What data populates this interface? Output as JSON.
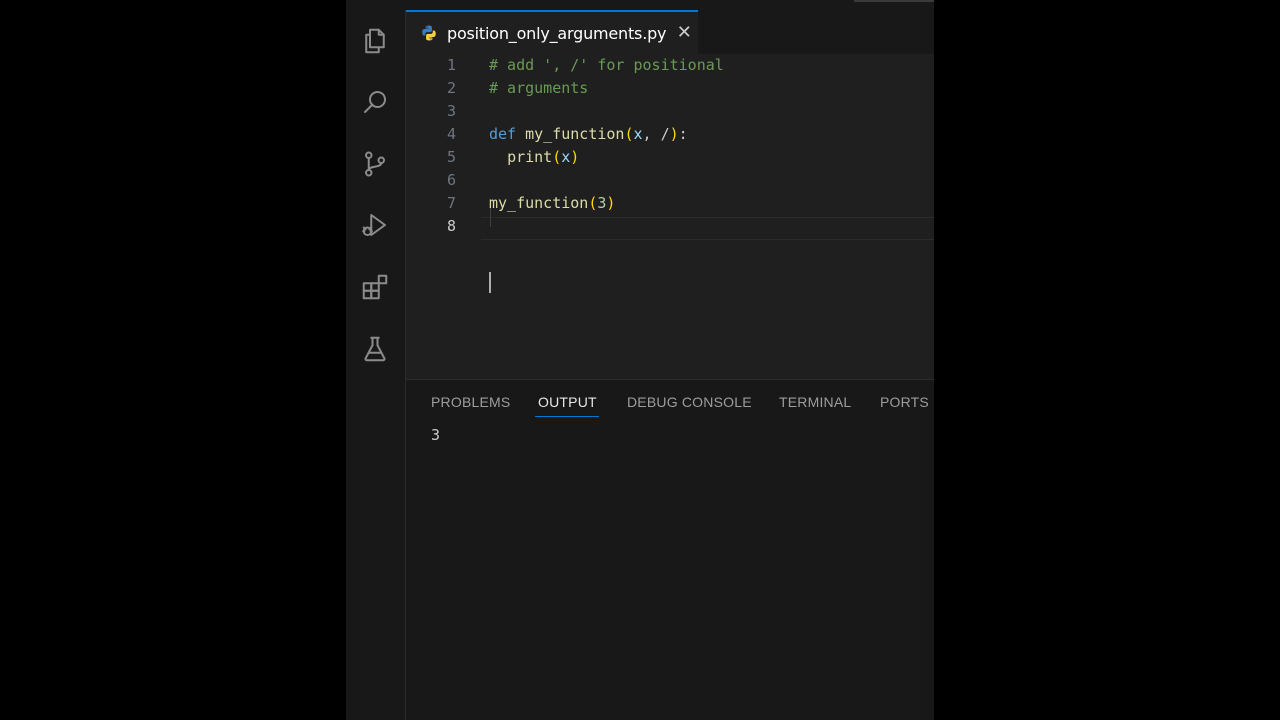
{
  "activity_bar": {
    "icons": [
      "explorer-icon",
      "search-icon",
      "source-control-icon",
      "run-debug-icon",
      "extensions-icon",
      "testing-icon"
    ]
  },
  "editor_tab": {
    "filename": "position_only_arguments.py",
    "close_glyph": "✕",
    "accent": "#0078d4"
  },
  "code_lines": [
    {
      "number": "1",
      "segments": [
        {
          "text": "# add ', /' for positional",
          "kind": "comment"
        }
      ]
    },
    {
      "number": "2",
      "segments": [
        {
          "text": "# arguments",
          "kind": "comment"
        }
      ]
    },
    {
      "number": "3",
      "segments": []
    },
    {
      "number": "4",
      "segments": [
        {
          "text": "def",
          "kind": "keyword"
        },
        {
          "text": " ",
          "kind": "plain"
        },
        {
          "text": "my_function",
          "kind": "function"
        },
        {
          "text": "(",
          "kind": "bracket"
        },
        {
          "text": "x",
          "kind": "variable"
        },
        {
          "text": ", /",
          "kind": "plain"
        },
        {
          "text": ")",
          "kind": "bracket"
        },
        {
          "text": ":",
          "kind": "plain"
        }
      ]
    },
    {
      "number": "5",
      "segments": [
        {
          "text": "  ",
          "kind": "plain"
        },
        {
          "text": "print",
          "kind": "function"
        },
        {
          "text": "(",
          "kind": "bracket"
        },
        {
          "text": "x",
          "kind": "variable"
        },
        {
          "text": ")",
          "kind": "bracket"
        }
      ]
    },
    {
      "number": "6",
      "segments": []
    },
    {
      "number": "7",
      "segments": [
        {
          "text": "my_function",
          "kind": "function"
        },
        {
          "text": "(",
          "kind": "bracket"
        },
        {
          "text": "3",
          "kind": "number"
        },
        {
          "text": ")",
          "kind": "bracket"
        }
      ]
    },
    {
      "number": "8",
      "segments": []
    }
  ],
  "active_line": "8",
  "panel": {
    "tabs": [
      {
        "label": "PROBLEMS",
        "active": false
      },
      {
        "label": "OUTPUT",
        "active": true
      },
      {
        "label": "DEBUG CONSOLE",
        "active": false
      },
      {
        "label": "TERMINAL",
        "active": false
      },
      {
        "label": "PORTS",
        "active": false
      }
    ],
    "output_text": "3"
  }
}
